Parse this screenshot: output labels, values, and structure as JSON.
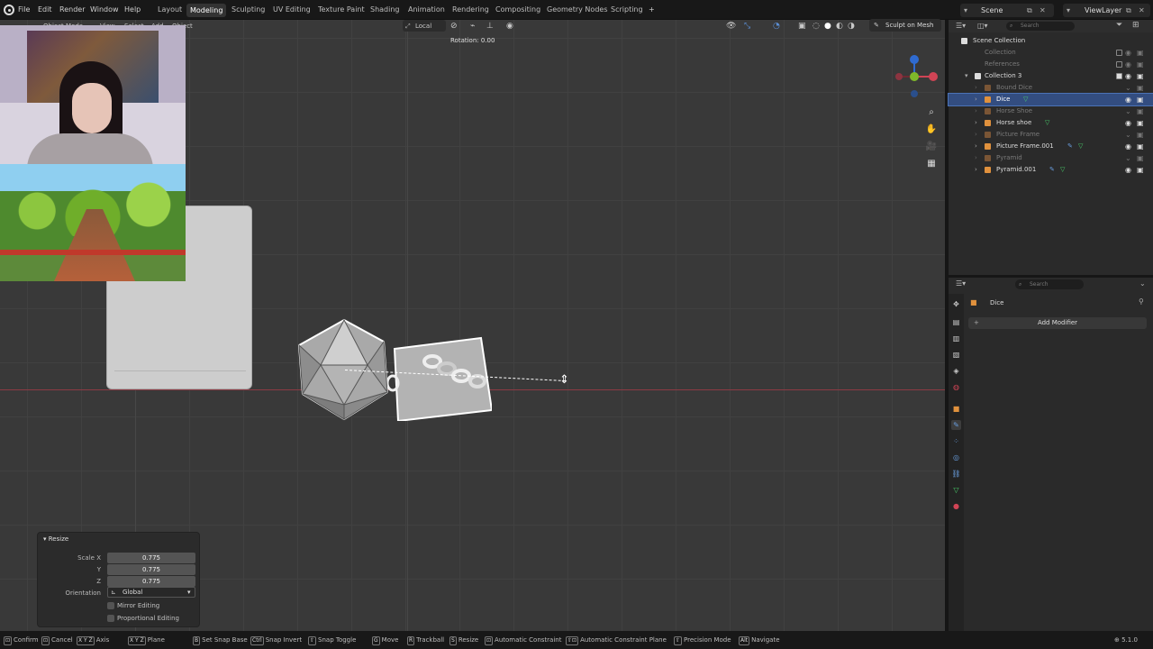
{
  "menu": {
    "items": [
      "File",
      "Edit",
      "Render",
      "Window",
      "Help"
    ],
    "workspaces": [
      "Layout",
      "Modeling",
      "Sculpting",
      "UV Editing",
      "Texture Paint",
      "Shading",
      "Animation",
      "Rendering",
      "Compositing",
      "Geometry Nodes",
      "Scripting"
    ],
    "active_workspace": "Modeling",
    "add_tab": "+",
    "scene": "Scene",
    "view_layer": "ViewLayer"
  },
  "viewport": {
    "mode": "Object Mode",
    "menus": [
      "View",
      "Select",
      "Add",
      "Object"
    ],
    "orientation": "Local",
    "sculpt_button": "Sculpt on Mesh",
    "rotation_text": "Rotation: 0.00"
  },
  "operator_panel": {
    "title": "Resize",
    "scale_x_label": "Scale X",
    "scale_y_label": "Y",
    "scale_z_label": "Z",
    "scale_x": "0.775",
    "scale_y": "0.775",
    "scale_z": "0.775",
    "orientation_label": "Orientation",
    "orientation_value": "Global",
    "mirror_label": "Mirror Editing",
    "proportional_label": "Proportional Editing"
  },
  "outliner": {
    "search_placeholder": "Search",
    "root": "Scene Collection",
    "rows": [
      {
        "label": "Collection",
        "dim": true
      },
      {
        "label": "References",
        "dim": true
      },
      {
        "label": "Collection 3",
        "dim": false
      },
      {
        "label": "Bound Dice",
        "dim": true
      },
      {
        "label": "Dice",
        "dim": false,
        "selected": true
      },
      {
        "label": "Horse Shoe",
        "dim": true
      },
      {
        "label": "Horse shoe",
        "dim": false
      },
      {
        "label": "Picture Frame",
        "dim": true
      },
      {
        "label": "Picture Frame.001",
        "dim": false
      },
      {
        "label": "Pyramid",
        "dim": true
      },
      {
        "label": "Pyramid.001",
        "dim": false
      }
    ]
  },
  "properties": {
    "search_placeholder": "Search",
    "object_name": "Dice",
    "add_modifier": "Add Modifier"
  },
  "status_bar": {
    "hints": [
      {
        "key": "",
        "label": "Confirm"
      },
      {
        "key": "",
        "label": "Cancel"
      },
      {
        "key": "X Y Z",
        "label": "Axis"
      },
      {
        "key": "X Y Z",
        "label": "Plane"
      },
      {
        "key": "B",
        "label": "Set Snap Base"
      },
      {
        "key": "Ctrl",
        "label": "Snap Invert"
      },
      {
        "key": "",
        "label": "Snap Toggle"
      },
      {
        "key": "G",
        "label": "Move"
      },
      {
        "key": "R",
        "label": "Trackball"
      },
      {
        "key": "S",
        "label": "Resize"
      },
      {
        "key": "",
        "label": "Automatic Constraint"
      },
      {
        "key": "",
        "label": "Automatic Constraint Plane"
      },
      {
        "key": "",
        "label": "Precision Mode"
      },
      {
        "key": "Alt",
        "label": "Navigate"
      }
    ],
    "version": "5.1.0"
  },
  "colors": {
    "accent": "#4772b3",
    "selected_row": "#334d80",
    "mesh_icon": "#e0913d",
    "data_icon": "#4ad16c"
  }
}
